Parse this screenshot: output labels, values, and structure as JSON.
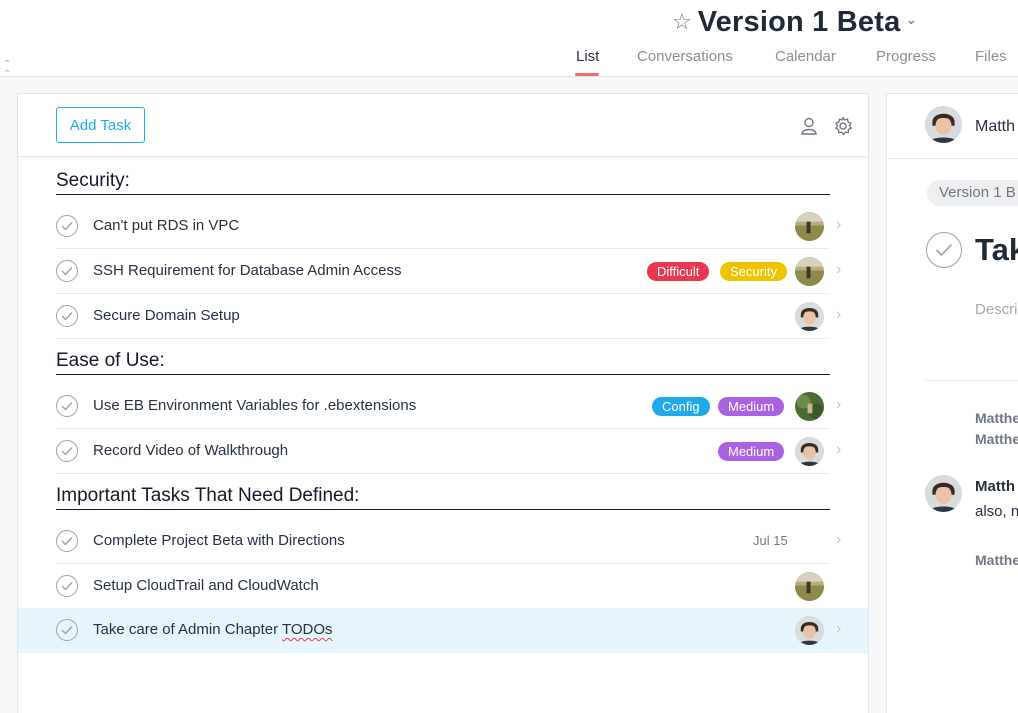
{
  "header": {
    "title": "Version 1 Beta",
    "tabs": [
      {
        "label": "List",
        "active": true
      },
      {
        "label": "Conversations"
      },
      {
        "label": "Calendar"
      },
      {
        "label": "Progress"
      },
      {
        "label": "Files"
      }
    ]
  },
  "toolbar": {
    "add_task_label": "Add Task"
  },
  "sections": [
    {
      "title": "Security:"
    },
    {
      "title": "Ease of Use:"
    },
    {
      "title": "Important Tasks That Need Defined:"
    }
  ],
  "tasks": [
    {
      "name": "Can't put RDS in VPC",
      "avatar": "field-photo"
    },
    {
      "name": "SSH Requirement for Database Admin Access",
      "tags": [
        {
          "label": "Difficult",
          "color": "#e8384f"
        },
        {
          "label": "Security",
          "color": "#eec300"
        }
      ],
      "avatar": "field-photo"
    },
    {
      "name": "Secure Domain Setup",
      "avatar": "portrait"
    },
    {
      "name": "Use EB Environment Variables for .ebextensions",
      "tags": [
        {
          "label": "Config",
          "color": "#20aaea"
        },
        {
          "label": "Medium",
          "color": "#aa62e3"
        }
      ],
      "avatar": "green-photo"
    },
    {
      "name": "Record Video of Walkthrough",
      "tags": [
        {
          "label": "Medium",
          "color": "#aa62e3"
        }
      ],
      "avatar": "portrait"
    },
    {
      "name": "Complete Project Beta with Directions",
      "due": "Jul 15"
    },
    {
      "name": "Setup CloudTrail and CloudWatch",
      "avatar": "field-photo"
    },
    {
      "name_prefix": "Take care of Admin Chapter ",
      "name_flagged": "TODOs",
      "avatar": "portrait",
      "selected": true
    }
  ],
  "detail": {
    "assignee": "Matth",
    "project": "Version 1 B",
    "title": "Tak",
    "description_placeholder": "Descri",
    "activity": [
      "Matthe",
      "Matthe"
    ],
    "comment": {
      "author": "Matth",
      "text": "also, n"
    },
    "activity_after": "Matthe"
  },
  "colors": {
    "accent": "#20aaea",
    "tab_underline": "#f06a6a",
    "selected_row": "#e6f5fb"
  },
  "icons": [
    "star-icon",
    "chevron-down-icon",
    "collapse-icon",
    "person-icon",
    "gear-icon",
    "check-icon",
    "chevron-right-icon"
  ]
}
